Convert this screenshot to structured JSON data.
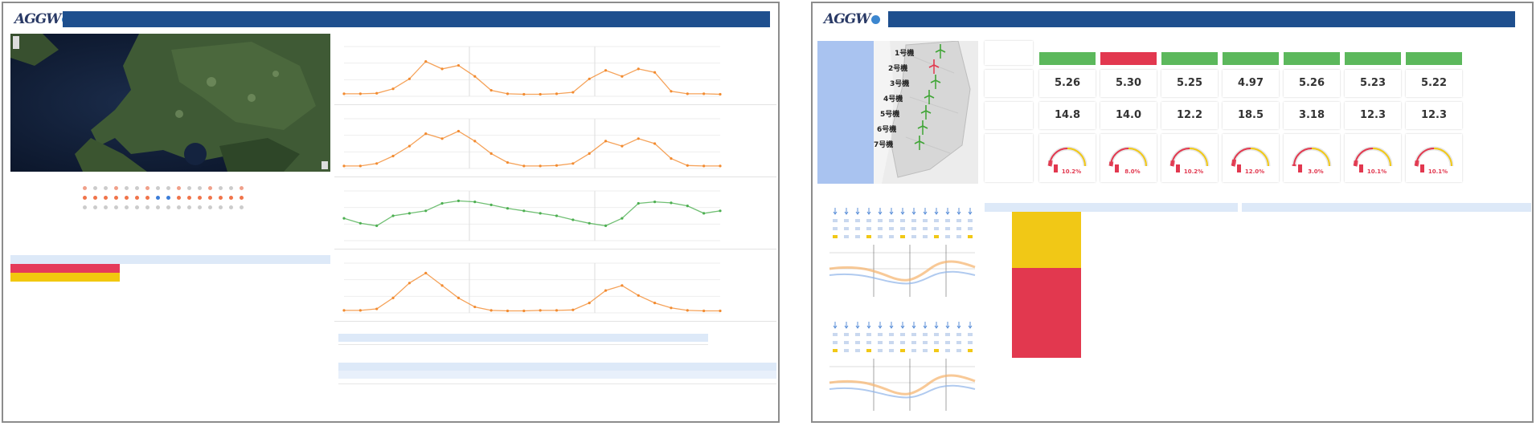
{
  "colors": {
    "header": "#1e4f8e",
    "alarm": "#e2384f",
    "warning": "#f1c816",
    "ok": "#5cb85c",
    "orange": "#f28b30",
    "green": "#4caf50",
    "tableHead": "#dde9f8"
  },
  "left": {
    "logo": "AGGW",
    "title": "",
    "map": {
      "alt": "satellite-map"
    },
    "charts": [
      {
        "title": "",
        "legend": [
          "",
          ""
        ]
      },
      {
        "title": "",
        "legend": [
          ""
        ]
      },
      {
        "title": "",
        "legend": []
      },
      {
        "title": "",
        "legend": [
          "",
          "",
          "",
          "",
          ""
        ]
      }
    ],
    "alert_panel": {
      "title": "",
      "headers": [
        "",
        "",
        ""
      ],
      "rows": [
        {
          "status": "",
          "text": "",
          "count": ""
        },
        {
          "status": "",
          "text": "",
          "count": ""
        }
      ]
    },
    "bottom_table": {
      "title": ""
    }
  },
  "right": {
    "logo": "AGGW",
    "title": "",
    "map_labels": [
      "1号機",
      "2号機",
      "3号機",
      "4号機",
      "5号機",
      "6号機",
      "7号機"
    ],
    "row_labels": [
      "",
      "",
      "",
      ""
    ],
    "units": [
      {
        "name": "",
        "status": "ok",
        "wind": "5.26",
        "power": "14.8",
        "gauge": "10.2"
      },
      {
        "name": "",
        "status": "alarm",
        "wind": "5.30",
        "power": "14.0",
        "gauge": "8.0"
      },
      {
        "name": "",
        "status": "ok",
        "wind": "5.25",
        "power": "12.2",
        "gauge": "10.2"
      },
      {
        "name": "",
        "status": "ok",
        "wind": "4.97",
        "power": "18.5",
        "gauge": "12.0"
      },
      {
        "name": "",
        "status": "ok",
        "wind": "5.26",
        "power": "3.18",
        "gauge": "3.0"
      },
      {
        "name": "",
        "status": "ok",
        "wind": "5.23",
        "power": "12.3",
        "gauge": "10.1"
      },
      {
        "name": "",
        "status": "ok",
        "wind": "5.22",
        "power": "12.3",
        "gauge": "10.1"
      }
    ],
    "alarm_table": {
      "title": "",
      "headers": [
        "",
        "",
        "",
        ""
      ],
      "rows": [
        {
          "unit": "",
          "level": "warn",
          "msg": "",
          "time": ""
        },
        {
          "unit": "",
          "level": "warn",
          "msg": "",
          "time": ""
        },
        {
          "unit": "",
          "level": "warn",
          "msg": "",
          "time": ""
        },
        {
          "unit": "",
          "level": "warn",
          "msg": "",
          "time": ""
        },
        {
          "unit": "",
          "level": "warn",
          "msg": "",
          "time": ""
        },
        {
          "unit": "",
          "level": "alarm",
          "msg": "",
          "time": ""
        },
        {
          "unit": "",
          "level": "alarm",
          "msg": "",
          "time": ""
        },
        {
          "unit": "",
          "level": "alarm",
          "msg": "",
          "time": ""
        },
        {
          "unit": "",
          "level": "alarm",
          "msg": "",
          "time": ""
        },
        {
          "unit": "",
          "level": "alarm",
          "msg": "",
          "time": ""
        },
        {
          "unit": "",
          "level": "alarm",
          "msg": "",
          "time": ""
        },
        {
          "unit": "",
          "level": "alarm",
          "msg": "",
          "time": ""
        },
        {
          "unit": "",
          "level": "alarm",
          "msg": "",
          "time": ""
        }
      ]
    },
    "history_table": {
      "title": "",
      "headers": [
        "",
        "",
        "",
        ""
      ],
      "rows": [
        {
          "unit": "",
          "msg": "",
          "time": ""
        },
        {
          "unit": "",
          "msg": "",
          "time": ""
        },
        {
          "unit": "",
          "msg": "",
          "time": ""
        },
        {
          "unit": "",
          "msg": "",
          "time": ""
        },
        {
          "unit": "",
          "msg": "",
          "time": ""
        },
        {
          "unit": "",
          "msg": "",
          "time": ""
        }
      ]
    },
    "forecast_title": ""
  }
}
